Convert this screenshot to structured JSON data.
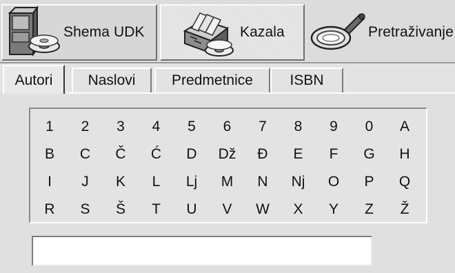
{
  "toolbar": {
    "buttons": [
      {
        "id": "udk",
        "label": "Shema UDK",
        "icon": "database-cd-icon"
      },
      {
        "id": "kazala",
        "label": "Kazala",
        "icon": "file-cabinet-cd-icon"
      },
      {
        "id": "pretraz",
        "label": "Pretraživanje",
        "icon": "magnifier-icon"
      }
    ]
  },
  "tabs": [
    {
      "label": "Autori",
      "active": true
    },
    {
      "label": "Naslovi",
      "active": false
    },
    {
      "label": "Predmetnice",
      "active": false
    },
    {
      "label": "ISBN",
      "active": false
    }
  ],
  "alphabet": {
    "rows": [
      [
        "1",
        "2",
        "3",
        "4",
        "5",
        "6",
        "7",
        "8",
        "9",
        "0",
        "A"
      ],
      [
        "B",
        "C",
        "Č",
        "Ć",
        "D",
        "Dž",
        "Đ",
        "E",
        "F",
        "G",
        "H"
      ],
      [
        "I",
        "J",
        "K",
        "L",
        "Lj",
        "M",
        "N",
        "Nj",
        "O",
        "P",
        "Q"
      ],
      [
        "R",
        "S",
        "Š",
        "T",
        "U",
        "V",
        "W",
        "X",
        "Y",
        "Z",
        "Ž"
      ]
    ]
  },
  "search": {
    "value": "",
    "placeholder": ""
  }
}
